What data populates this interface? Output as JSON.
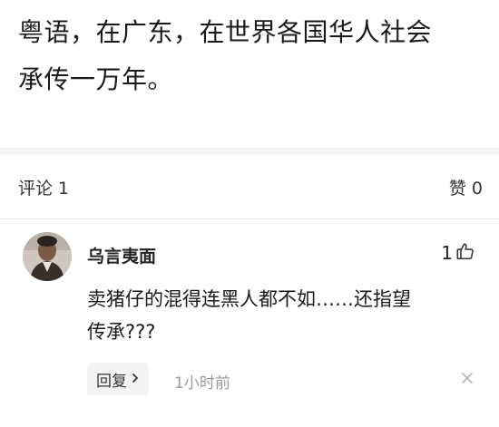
{
  "post": {
    "line1": "粤语，在广东，在世界各国华人社会",
    "line2": "承传一万年。"
  },
  "stats": {
    "comments": "评论 1",
    "likes": "赞 0"
  },
  "comment": {
    "author": "乌言夷面",
    "like_count": "1",
    "text_line1": "卖猪仔的混得连黑人都不如……还指望",
    "text_line2": "传承???",
    "reply_label": "回复",
    "time": "1小时前"
  },
  "icons": {
    "like": "thumbs-up-icon",
    "reply_arrow": "chevron-right-icon",
    "close": "close-icon"
  },
  "colors": {
    "divider": "#ececec",
    "band": "#f4f4f4",
    "muted_text": "#9a9a9a",
    "reply_bg": "#f3f3f3"
  }
}
